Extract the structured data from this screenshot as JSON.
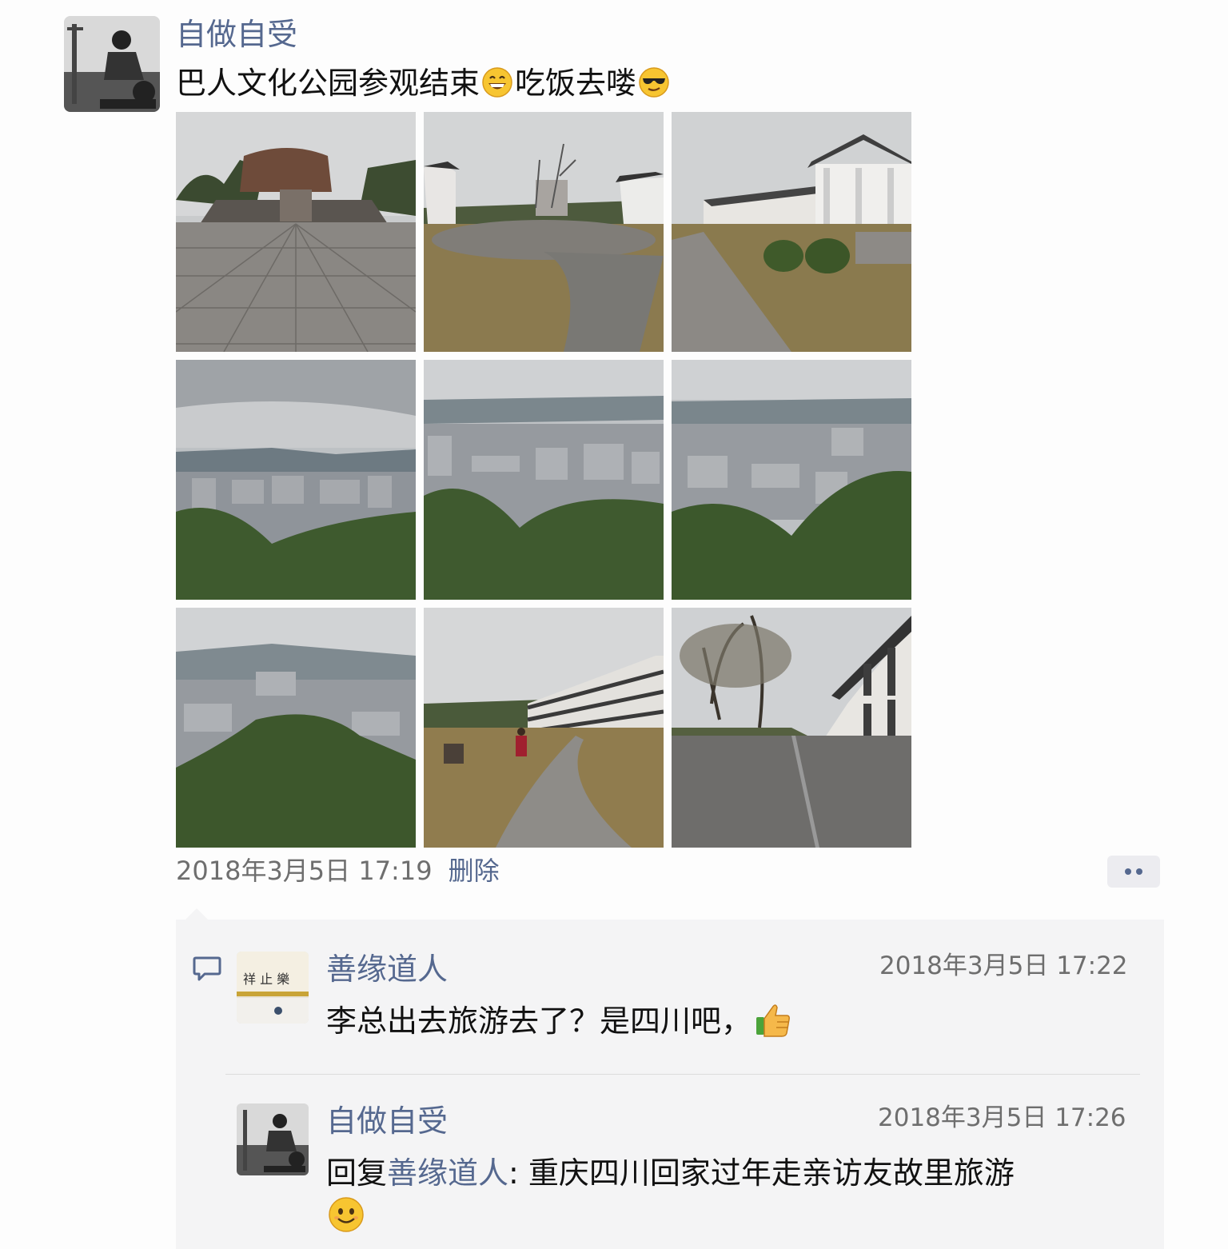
{
  "post": {
    "author": "自做自受",
    "text_part1": "巴人文化公园参观结束",
    "emoji1": "grinning-face-emoji",
    "text_part2": "吃饭去喽",
    "emoji2": "sunglasses-face-emoji",
    "timestamp": "2018年3月5日 17:19",
    "delete_label": "删除"
  },
  "comments": [
    {
      "author": "善缘道人",
      "time": "2018年3月5日 17:22",
      "text": "李总出去旅游去了？是四川吧，",
      "emoji": "thumbs-up-emoji"
    },
    {
      "author": "自做自受",
      "time": "2018年3月5日 17:26",
      "reply_prefix": "回复",
      "reply_to": "善缘道人",
      "text": ": 重庆四川回家过年走亲访友故里旅游",
      "emoji": "smiling-face-emoji"
    }
  ],
  "icons": {
    "comment": "comment-bubble-icon",
    "more": "more-dots-icon"
  },
  "colors": {
    "link": "#55688f",
    "meta": "#6e6e6e",
    "comment_bg": "#f4f4f5"
  }
}
